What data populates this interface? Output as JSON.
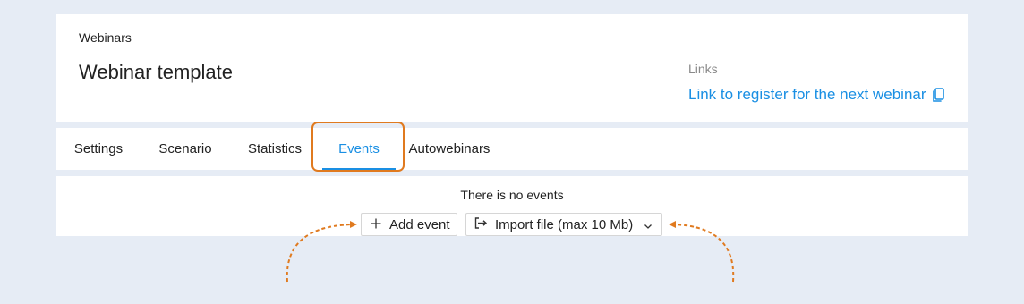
{
  "header": {
    "breadcrumb": "Webinars",
    "title": "Webinar template",
    "links_caption": "Links",
    "register_link": "Link to register for the next webinar"
  },
  "tabs": [
    {
      "label": "Settings",
      "active": false
    },
    {
      "label": "Scenario",
      "active": false
    },
    {
      "label": "Statistics",
      "active": false
    },
    {
      "label": "Events",
      "active": true
    },
    {
      "label": "Autowebinars",
      "active": false
    }
  ],
  "events": {
    "empty_text": "There is no events",
    "add_button": "Add event",
    "import_button": "Import file (max 10 Mb)"
  },
  "icons": {
    "copy": "copy-icon",
    "add": "plus-icon",
    "import": "import-icon",
    "dropdown": "chevron-down-icon"
  },
  "colors": {
    "accent": "#1a8fe3",
    "highlight": "#e07a1f",
    "background": "#e6ecf5"
  }
}
